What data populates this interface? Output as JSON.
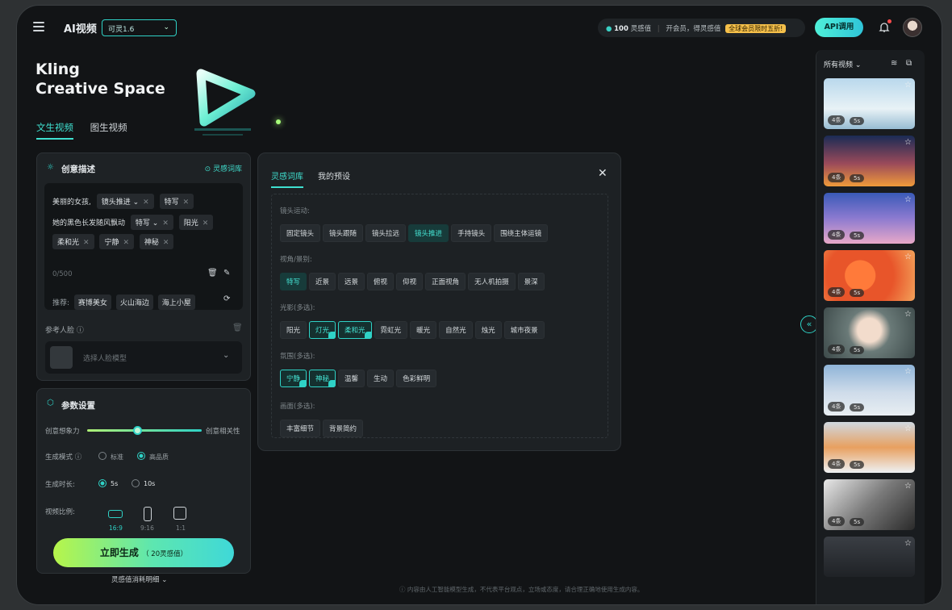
{
  "header": {
    "menu_icon": "menu-icon",
    "app_title": "AI视频",
    "model_select": "可灵1.6",
    "credits_amount": "100",
    "credits_label": "灵感值",
    "member_text": "开会员，得灵感值",
    "promo_badge": "全球会员限时五折!",
    "api_button": "API调用"
  },
  "hero": {
    "title": "Kling\nCreative Space"
  },
  "tabs": [
    "文生视频",
    "图生视频"
  ],
  "creative": {
    "title": "创意描述",
    "inspiration_link": "灵感词库",
    "prompt_line1_text": "美丽的女孩,",
    "prompt_line1_chips": [
      "镜头推进",
      "特写"
    ],
    "prompt_line2_text": "她的黑色长发随风飘动",
    "prompt_line2_chips": [
      "特写",
      "阳光"
    ],
    "prompt_line3_chips": [
      "柔和光",
      "宁静",
      "神秘"
    ],
    "counter": "0/500",
    "recommend_label": "推荐:",
    "recommend_chips": [
      "赛博美女",
      "火山海边",
      "海上小屋"
    ],
    "reference_label": "参考人脸",
    "face_placeholder": "选择人脸模型"
  },
  "params": {
    "title": "参数设置",
    "creativity_left": "创意想象力",
    "creativity_right": "创意相关性",
    "mode_label": "生成模式",
    "mode_options": [
      "标准",
      "高品质"
    ],
    "duration_label": "生成时长:",
    "duration_options": [
      "5s",
      "10s"
    ],
    "ratio_label": "视频比例:",
    "ratios": [
      "16:9",
      "9:16",
      "1:1"
    ]
  },
  "generate": {
    "button_label": "立即生成",
    "cost": "20灵感值",
    "cost_detail": "灵感值消耗明细"
  },
  "library": {
    "tabs": [
      "灵感词库",
      "我的预设"
    ],
    "sections": [
      {
        "label": "镜头运动:",
        "tags": [
          "固定镜头",
          "镜头跟随",
          "镜头拉远",
          "镜头推进",
          "手持镜头",
          "围绕主体运镜"
        ]
      },
      {
        "label": "视角/景别:",
        "tags": [
          "特写",
          "近景",
          "远景",
          "俯视",
          "仰视",
          "正面视角",
          "无人机拍摄",
          "景深"
        ]
      },
      {
        "label": "光影(多选):",
        "tags": [
          "阳光",
          "灯光",
          "柔和光",
          "霓虹光",
          "暖光",
          "自然光",
          "烛光",
          "城市夜景"
        ]
      },
      {
        "label": "氛围(多选):",
        "tags": [
          "宁静",
          "神秘",
          "温馨",
          "生动",
          "色彩鲜明"
        ]
      },
      {
        "label": "画面(多选):",
        "tags": [
          "丰富细节",
          "背景简约"
        ]
      }
    ]
  },
  "sidebar": {
    "filter_label": "所有视频",
    "videos": [
      {
        "count": "4条",
        "duration": "5s"
      },
      {
        "count": "4条",
        "duration": "5s"
      },
      {
        "count": "4条",
        "duration": "5s"
      },
      {
        "count": "4条",
        "duration": "5s"
      },
      {
        "count": "4条",
        "duration": "5s"
      },
      {
        "count": "4条",
        "duration": "5s"
      },
      {
        "count": "4条",
        "duration": "5s"
      },
      {
        "count": "4条",
        "duration": "5s"
      },
      {
        "count": "",
        "duration": ""
      }
    ]
  },
  "footer_note": "内容由人工智能模型生成，不代表平台观点，立场或态度，请合理正确地使用生成内容。",
  "colors": {
    "accent": "#2fd2c6",
    "background": "#121416",
    "panel": "#1e2225",
    "generate_gradient_start": "#b7f54a",
    "generate_gradient_end": "#3fd8d8"
  }
}
